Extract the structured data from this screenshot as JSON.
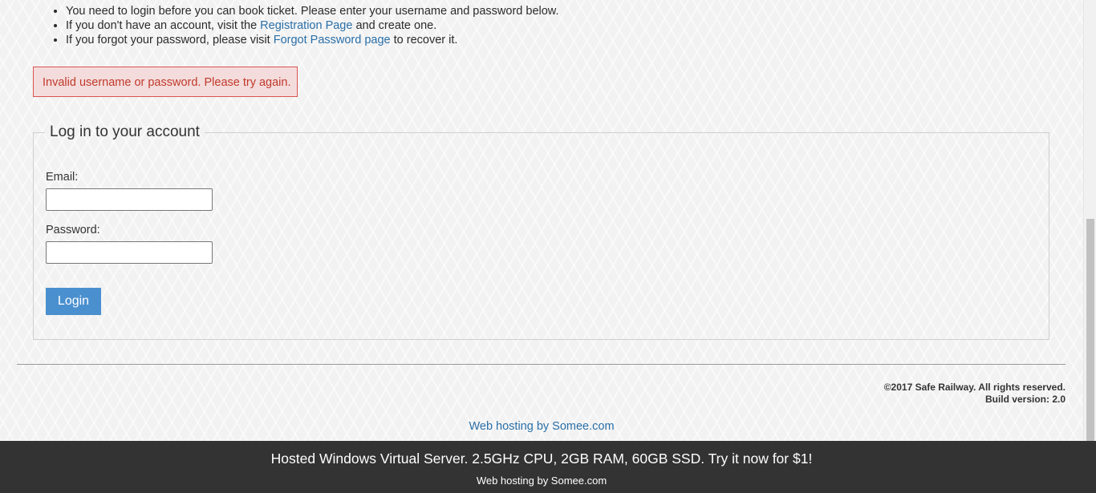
{
  "instructions": {
    "line1": "You need to login before you can book ticket. Please enter your username and password below.",
    "line2_pre": "If you don't have an account, visit the ",
    "line2_link": "Registration Page",
    "line2_post": " and create one.",
    "line3_pre": "If you forgot your password, please visit ",
    "line3_link": "Forgot Password page",
    "line3_post": " to recover it."
  },
  "error": {
    "message": "Invalid username or password. Please try again."
  },
  "login_form": {
    "legend": "Log in to your account",
    "email_label": "Email:",
    "email_value": "",
    "password_label": "Password:",
    "password_value": "",
    "login_button": "Login"
  },
  "footer": {
    "copyright": "©2017 Safe Railway. All rights reserved.",
    "build": "Build version: 2.0",
    "hosting_link": "Web hosting by Somee.com"
  },
  "banner": {
    "main": "Hosted Windows Virtual Server. 2.5GHz CPU, 2GB RAM, 60GB SSD. Try it now for $1!",
    "sub": "Web hosting by Somee.com"
  },
  "colors": {
    "link": "#2a6fa8",
    "error_text": "#c0392b",
    "error_border": "#d9534f",
    "button": "#4a90cf",
    "banner_bg": "#333333"
  }
}
